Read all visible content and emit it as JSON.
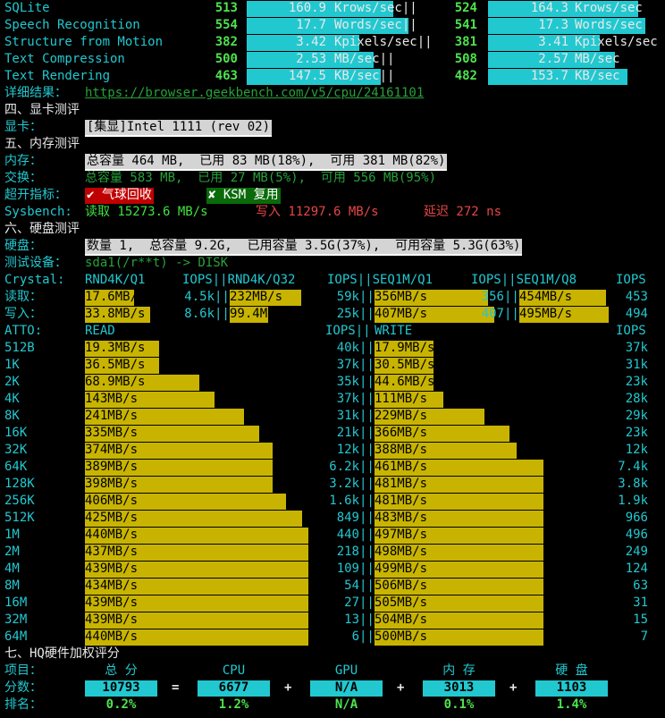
{
  "gb_rows": [
    {
      "name": "SQLite",
      "s1": "513",
      "v1": "160.9",
      "u1": "Krows/sec||",
      "s2": "524",
      "v2": "164.3",
      "u2": "Krows/sec",
      "f1": 0.83,
      "f2": 0.86
    },
    {
      "name": "Speech Recognition",
      "s1": "554",
      "v1": "17.7",
      "u1": "Words/sec||",
      "s2": "541",
      "v2": "17.3",
      "u2": "Words/sec",
      "f1": 0.92,
      "f2": 0.9
    },
    {
      "name": "Structure from Motion",
      "s1": "382",
      "v1": "3.42",
      "u1": "Kpixels/sec||",
      "s2": "381",
      "v2": "3.41",
      "u2": "Kpixels/sec",
      "f1": 0.64,
      "f2": 0.64
    },
    {
      "name": "Text Compression",
      "s1": "500",
      "v1": "2.53",
      "u1": "MB/sec||",
      "s2": "508",
      "v2": "2.57",
      "u2": "MB/sec",
      "f1": 0.72,
      "f2": 0.73
    },
    {
      "name": "Text Rendering",
      "s1": "463",
      "v1": "147.5",
      "u1": "KB/sec||",
      "s2": "482",
      "v2": "153.7",
      "u2": "KB/sec",
      "f1": 0.76,
      "f2": 0.8
    }
  ],
  "detail": {
    "label": "详细结果：",
    "url": "https://browser.geekbench.com/v5/cpu/24161101"
  },
  "sec4": {
    "title": "四、显卡测评",
    "gpu_label": "显卡：",
    "gpu_value": "[集显]Intel 1111 (rev 02)"
  },
  "sec5": {
    "title": "五、内存测评",
    "mem_label": "内存：",
    "mem_value": "总容量 464 MB,  已用 83 MB(18%),  可用 381 MB(82%)",
    "swap_label": "交换：",
    "swap_value": "总容量 583 MB,  已用 27 MB(5%),  可用 556 MB(95%)",
    "oc_label": "超开指标：",
    "balloon": "✔ 气球回收",
    "ksm": "✘ KSM 复用",
    "sys_label": "Sysbench:",
    "read": "读取 15273.6 MB/s",
    "write": "写入 11297.6 MB/s",
    "latency": "延迟 272 ns"
  },
  "sec6": {
    "title": "六、硬盘测评",
    "disk_label": "硬盘：",
    "disk_value": "数量 1,  总容量 9.2G,  已用容量 3.5G(37%),  可用容量 5.3G(63%)",
    "dev_label": "测试设备：",
    "dev_value": "sda1(/r**t) -> DISK",
    "crystal_label": "Crystal:",
    "crystal_headers": [
      "RND4K/Q1",
      "IOPS||RND4K/Q32",
      "IOPS||SEQ1M/Q1",
      "IOPS||SEQ1M/Q8",
      "IOPS"
    ],
    "crystal_rows": [
      {
        "label": "读取：",
        "cells": [
          {
            "v": "17.6MB/s",
            "i": "4.5k",
            "f": 0.37
          },
          {
            "v": "232MB/s",
            "i": "59k",
            "f": 0.99
          },
          {
            "v": "356MB/s",
            "i": "356",
            "f": 0.87
          },
          {
            "v": "454MB/s",
            "i": "453",
            "f": 0.97
          }
        ]
      },
      {
        "label": "写入：",
        "cells": [
          {
            "v": "33.8MB/s",
            "i": "8.6k",
            "f": 0.49
          },
          {
            "v": "99.4MB/s",
            "i": "25k",
            "f": 0.53
          },
          {
            "v": "407MB/s",
            "i": "407",
            "f": 0.92
          },
          {
            "v": "495MB/s",
            "i": "494",
            "f": 1.0
          }
        ]
      }
    ],
    "atto_label": "ATTO:",
    "atto_read": "READ",
    "atto_iops": "IOPS||",
    "atto_write": "WRITE",
    "atto_iops2": "IOPS",
    "atto_rows": [
      {
        "sz": "512B",
        "r": "19.3MB/s",
        "ri": "40k",
        "w": "17.9MB/s",
        "wi": "37k",
        "rf": 0.33,
        "wf": 0.35
      },
      {
        "sz": "1K",
        "r": "36.5MB/s",
        "ri": "37k",
        "w": "30.5MB/s",
        "wi": "31k",
        "rf": 0.33,
        "wf": 0.35
      },
      {
        "sz": "2K",
        "r": "68.9MB/s",
        "ri": "35k",
        "w": "44.6MB/s",
        "wi": "23k",
        "rf": 0.51,
        "wf": 0.35
      },
      {
        "sz": "4K",
        "r": "143MB/s",
        "ri": "37k",
        "w": "111MB/s",
        "wi": "28k",
        "rf": 0.58,
        "wf": 0.41
      },
      {
        "sz": "8K",
        "r": "241MB/s",
        "ri": "31k",
        "w": "229MB/s",
        "wi": "29k",
        "rf": 0.71,
        "wf": 0.65
      },
      {
        "sz": "16K",
        "r": "335MB/s",
        "ri": "21k",
        "w": "366MB/s",
        "wi": "23k",
        "rf": 0.78,
        "wf": 0.8
      },
      {
        "sz": "32K",
        "r": "374MB/s",
        "ri": "12k",
        "w": "388MB/s",
        "wi": "12k",
        "rf": 0.84,
        "wf": 0.84
      },
      {
        "sz": "64K",
        "r": "389MB/s",
        "ri": "6.2k",
        "w": "461MB/s",
        "wi": "7.4k",
        "rf": 0.84,
        "wf": 1.0
      },
      {
        "sz": "128K",
        "r": "398MB/s",
        "ri": "3.2k",
        "w": "481MB/s",
        "wi": "3.8k",
        "rf": 0.84,
        "wf": 1.0
      },
      {
        "sz": "256K",
        "r": "406MB/s",
        "ri": "1.6k",
        "w": "481MB/s",
        "wi": "1.9k",
        "rf": 0.9,
        "wf": 1.0
      },
      {
        "sz": "512K",
        "r": "425MB/s",
        "ri": "849",
        "w": "483MB/s",
        "wi": "966",
        "rf": 0.97,
        "wf": 1.0
      },
      {
        "sz": "1M",
        "r": "440MB/s",
        "ri": "440",
        "w": "497MB/s",
        "wi": "496",
        "rf": 1.0,
        "wf": 1.0
      },
      {
        "sz": "2M",
        "r": "437MB/s",
        "ri": "218",
        "w": "498MB/s",
        "wi": "249",
        "rf": 1.0,
        "wf": 1.0
      },
      {
        "sz": "4M",
        "r": "439MB/s",
        "ri": "109",
        "w": "499MB/s",
        "wi": "124",
        "rf": 1.0,
        "wf": 1.0
      },
      {
        "sz": "8M",
        "r": "434MB/s",
        "ri": "54",
        "w": "506MB/s",
        "wi": "63",
        "rf": 1.0,
        "wf": 1.0
      },
      {
        "sz": "16M",
        "r": "439MB/s",
        "ri": "27",
        "w": "505MB/s",
        "wi": "31",
        "rf": 1.0,
        "wf": 1.0
      },
      {
        "sz": "32M",
        "r": "439MB/s",
        "ri": "13",
        "w": "504MB/s",
        "wi": "15",
        "rf": 1.0,
        "wf": 1.0
      },
      {
        "sz": "64M",
        "r": "440MB/s",
        "ri": "6",
        "w": "500MB/s",
        "wi": "7",
        "rf": 1.0,
        "wf": 1.0
      }
    ]
  },
  "sec7": {
    "title": "七、HQ硬件加权评分",
    "item_label": "项目：",
    "score_label": "分数：",
    "rank_label": "排名：",
    "headers": [
      "总 分",
      "CPU",
      "GPU",
      "内 存",
      "硬 盘"
    ],
    "scores": [
      "10793",
      "6677",
      "N/A",
      "3013",
      "1103"
    ],
    "ops": [
      "=",
      "+",
      "+",
      "+"
    ],
    "ranks": [
      "0.2%",
      "1.2%",
      "N/A",
      "0.1%",
      "1.4%"
    ]
  },
  "colors": {
    "cyan": "#22c8d0",
    "yellow": "#c8b400",
    "green": "#3fe23f",
    "red": "#e84545"
  }
}
